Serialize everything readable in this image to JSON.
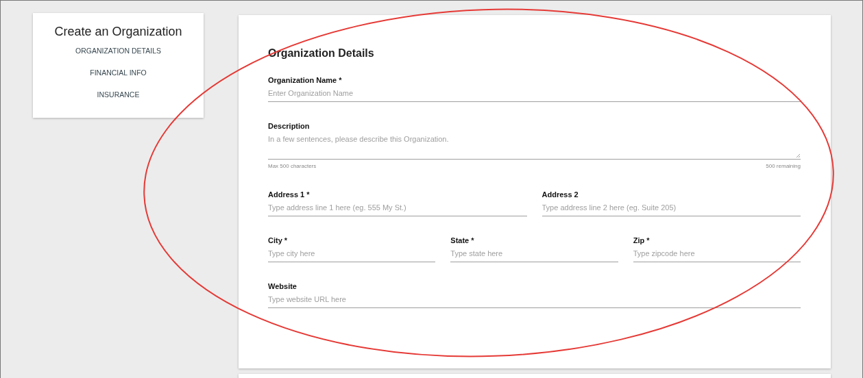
{
  "sidebar": {
    "title": "Create an Organization",
    "items": [
      {
        "label": "ORGANIZATION DETAILS"
      },
      {
        "label": "FINANCIAL INFO"
      },
      {
        "label": "INSURANCE"
      }
    ]
  },
  "form": {
    "title": "Organization Details",
    "name": {
      "kind": "input",
      "label": "Organization Name *",
      "placeholder": "Enter Organization Name"
    },
    "description": {
      "kind": "textarea",
      "label": "Description",
      "placeholder": "In a few sentences, please describe this Organization.",
      "hint": "Max 500 characters",
      "counter": "500 remaining"
    },
    "address": {
      "line_1": {
        "kind": "input",
        "label": "Address 1 *",
        "placeholder": "Type address line 1 here (eg. 555 My St.)"
      },
      "line_2": {
        "kind": "input",
        "label": "Address 2",
        "placeholder": "Type address line 2 here (eg. Suite 205)"
      }
    },
    "location": {
      "city": {
        "kind": "input",
        "label": "City *",
        "placeholder": "Type city here"
      },
      "state": {
        "kind": "input",
        "label": "State *",
        "placeholder": "Type state here"
      },
      "zip": {
        "kind": "input",
        "label": "Zip *",
        "placeholder": "Type zipcode here"
      }
    },
    "website": {
      "kind": "input",
      "label": "Website",
      "placeholder": "Type website URL here"
    }
  }
}
